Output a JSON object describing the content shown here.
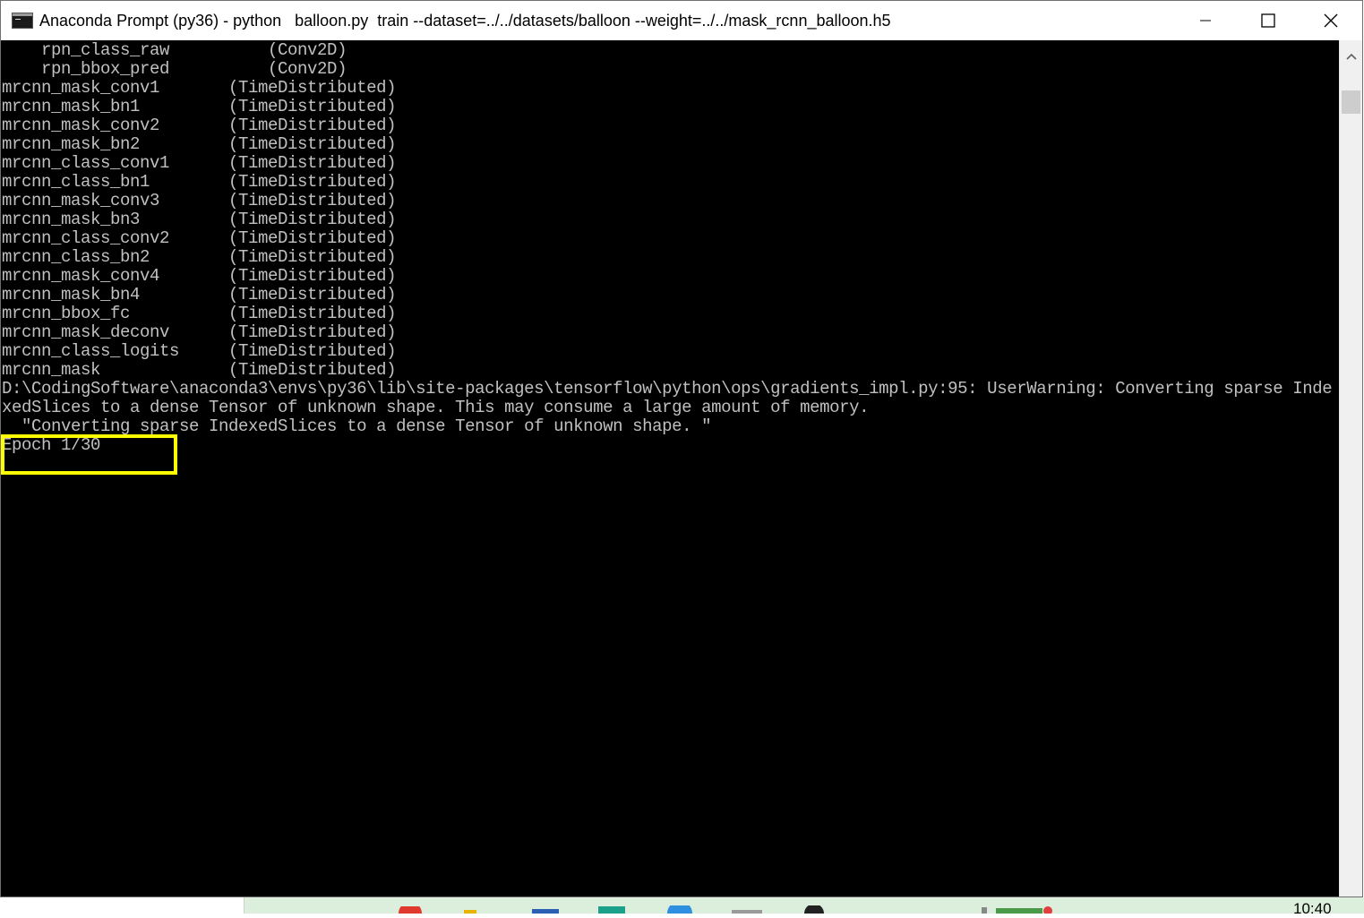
{
  "window": {
    "title": "Anaconda Prompt (py36) - python   balloon.py  train --dataset=../../datasets/balloon --weight=../../mask_rcnn_balloon.h5"
  },
  "console": {
    "lines": [
      "    rpn_class_raw          (Conv2D)",
      "    rpn_bbox_pred          (Conv2D)",
      "mrcnn_mask_conv1       (TimeDistributed)",
      "mrcnn_mask_bn1         (TimeDistributed)",
      "mrcnn_mask_conv2       (TimeDistributed)",
      "mrcnn_mask_bn2         (TimeDistributed)",
      "mrcnn_class_conv1      (TimeDistributed)",
      "mrcnn_class_bn1        (TimeDistributed)",
      "mrcnn_mask_conv3       (TimeDistributed)",
      "mrcnn_mask_bn3         (TimeDistributed)",
      "mrcnn_class_conv2      (TimeDistributed)",
      "mrcnn_class_bn2        (TimeDistributed)",
      "mrcnn_mask_conv4       (TimeDistributed)",
      "mrcnn_mask_bn4         (TimeDistributed)",
      "mrcnn_bbox_fc          (TimeDistributed)",
      "mrcnn_mask_deconv      (TimeDistributed)",
      "mrcnn_class_logits     (TimeDistributed)",
      "mrcnn_mask             (TimeDistributed)",
      "D:\\CodingSoftware\\anaconda3\\envs\\py36\\lib\\site-packages\\tensorflow\\python\\ops\\gradients_impl.py:95: UserWarning: Converting sparse Inde",
      "xedSlices to a dense Tensor of unknown shape. This may consume a large amount of memory.",
      "  \"Converting sparse IndexedSlices to a dense Tensor of unknown shape. \"",
      "Epoch 1/30"
    ]
  },
  "taskbar": {
    "clock": "10:40"
  },
  "colors": {
    "terminal_bg": "#000000",
    "terminal_fg": "#c0c0c0",
    "highlight": "#ffff00"
  }
}
